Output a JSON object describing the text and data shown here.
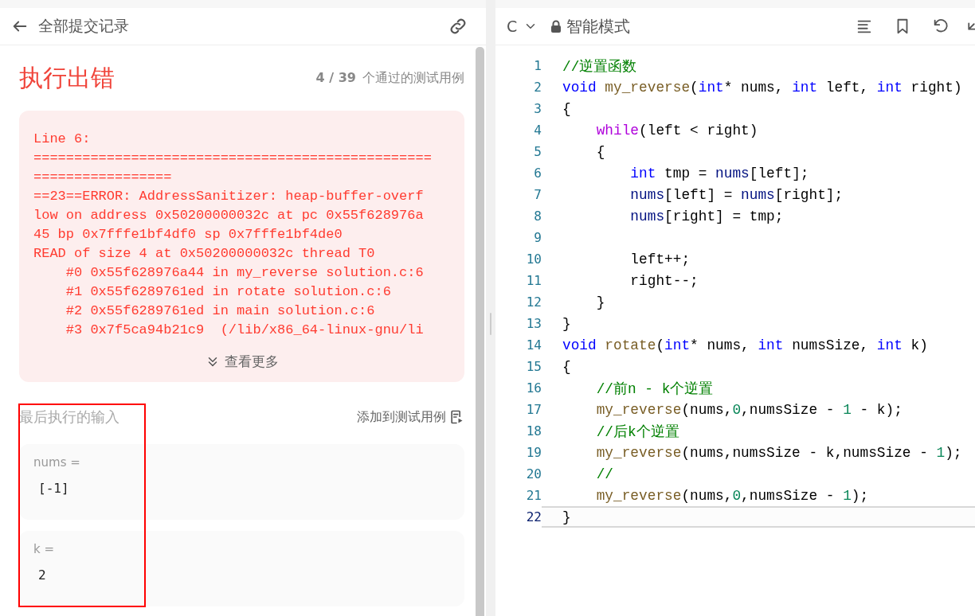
{
  "header": {
    "title": "全部提交记录"
  },
  "result": {
    "status": "执行出错",
    "passed": "4 / 39",
    "passed_label": "个通过的测试用例"
  },
  "error": {
    "lines": [
      "Line 6:",
      "=================================================",
      "=================",
      "==23==ERROR: AddressSanitizer: heap-buffer-overf",
      "low on address 0x50200000032c at pc 0x55f628976a",
      "45 bp 0x7fffe1bf4df0 sp 0x7fffe1bf4de0",
      "READ of size 4 at 0x50200000032c thread T0",
      "    #0 0x55f628976a44 in my_reverse solution.c:6",
      "    #1 0x55f6289761ed in rotate solution.c:6",
      "    #2 0x55f6289761ed in main solution.c:6",
      "    #3 0x7f5ca94b21c9  (/lib/x86_64-linux-gnu/li"
    ],
    "more": "查看更多"
  },
  "last_input": {
    "title": "最后执行的输入",
    "add_link": "添加到测试用例",
    "params": [
      {
        "name": "nums =",
        "value": "[-1]"
      },
      {
        "name": "k =",
        "value": "2"
      }
    ]
  },
  "editor": {
    "language": "C",
    "mode": "智能模式",
    "lines": [
      {
        "number": "1",
        "active": false,
        "tokens": [
          {
            "kind": "comment",
            "text": "//逆置函数"
          }
        ]
      },
      {
        "number": "2",
        "active": false,
        "tokens": [
          {
            "kind": "kw",
            "text": "void "
          },
          {
            "kind": "fn",
            "text": "my_reverse"
          },
          {
            "kind": "plain",
            "text": "("
          },
          {
            "kind": "kw",
            "text": "int"
          },
          {
            "kind": "plain",
            "text": "* nums, "
          },
          {
            "kind": "kw",
            "text": "int"
          },
          {
            "kind": "plain",
            "text": " left, "
          },
          {
            "kind": "kw",
            "text": "int"
          },
          {
            "kind": "plain",
            "text": " right)"
          }
        ]
      },
      {
        "number": "3",
        "active": false,
        "tokens": [
          {
            "kind": "plain",
            "text": "{"
          }
        ]
      },
      {
        "number": "4",
        "active": false,
        "tokens": [
          {
            "kind": "ctrl",
            "text": "    while"
          },
          {
            "kind": "plain",
            "text": "(left < right)"
          }
        ]
      },
      {
        "number": "5",
        "active": false,
        "tokens": [
          {
            "kind": "plain",
            "text": "    {"
          }
        ]
      },
      {
        "number": "6",
        "active": false,
        "tokens": [
          {
            "kind": "kw",
            "text": "        int"
          },
          {
            "kind": "plain",
            "text": " tmp = "
          },
          {
            "kind": "var",
            "text": "nums"
          },
          {
            "kind": "plain",
            "text": "[left];"
          }
        ]
      },
      {
        "number": "7",
        "active": false,
        "tokens": [
          {
            "kind": "var",
            "text": "        nums"
          },
          {
            "kind": "plain",
            "text": "[left] = "
          },
          {
            "kind": "var",
            "text": "nums"
          },
          {
            "kind": "plain",
            "text": "[right];"
          }
        ]
      },
      {
        "number": "8",
        "active": false,
        "tokens": [
          {
            "kind": "var",
            "text": "        nums"
          },
          {
            "kind": "plain",
            "text": "[right] = tmp;"
          }
        ]
      },
      {
        "number": "9",
        "active": false
      },
      {
        "number": "10",
        "active": false,
        "tokens": [
          {
            "kind": "plain",
            "text": "        left++;"
          }
        ]
      },
      {
        "number": "11",
        "active": false,
        "tokens": [
          {
            "kind": "plain",
            "text": "        right--;"
          }
        ]
      },
      {
        "number": "12",
        "active": false,
        "tokens": [
          {
            "kind": "plain",
            "text": "    }"
          }
        ]
      },
      {
        "number": "13",
        "active": false,
        "tokens": [
          {
            "kind": "plain",
            "text": "}"
          }
        ]
      },
      {
        "number": "14",
        "active": false,
        "tokens": [
          {
            "kind": "kw",
            "text": "void "
          },
          {
            "kind": "fn",
            "text": "rotate"
          },
          {
            "kind": "plain",
            "text": "("
          },
          {
            "kind": "kw",
            "text": "int"
          },
          {
            "kind": "plain",
            "text": "* nums, "
          },
          {
            "kind": "kw",
            "text": "int"
          },
          {
            "kind": "plain",
            "text": " numsSize, "
          },
          {
            "kind": "kw",
            "text": "int"
          },
          {
            "kind": "plain",
            "text": " k)"
          }
        ]
      },
      {
        "number": "15",
        "active": false,
        "tokens": [
          {
            "kind": "plain",
            "text": "{"
          }
        ]
      },
      {
        "number": "16",
        "active": false,
        "tokens": [
          {
            "kind": "comment",
            "text": "    //前n - k个逆置"
          }
        ]
      },
      {
        "number": "17",
        "active": false,
        "tokens": [
          {
            "kind": "fn",
            "text": "    my_reverse"
          },
          {
            "kind": "plain",
            "text": "(nums,"
          },
          {
            "kind": "num",
            "text": "0"
          },
          {
            "kind": "plain",
            "text": ",numsSize - "
          },
          {
            "kind": "num",
            "text": "1"
          },
          {
            "kind": "plain",
            "text": " - k);"
          }
        ]
      },
      {
        "number": "18",
        "active": false,
        "tokens": [
          {
            "kind": "comment",
            "text": "    //后k个逆置"
          }
        ]
      },
      {
        "number": "19",
        "active": false,
        "tokens": [
          {
            "kind": "fn",
            "text": "    my_reverse"
          },
          {
            "kind": "plain",
            "text": "(nums,numsSize - k,numsSize - "
          },
          {
            "kind": "num",
            "text": "1"
          },
          {
            "kind": "plain",
            "text": ");"
          }
        ]
      },
      {
        "number": "20",
        "active": false,
        "tokens": [
          {
            "kind": "comment",
            "text": "    //"
          }
        ]
      },
      {
        "number": "21",
        "active": false,
        "tokens": [
          {
            "kind": "fn",
            "text": "    my_reverse"
          },
          {
            "kind": "plain",
            "text": "(nums,"
          },
          {
            "kind": "num",
            "text": "0"
          },
          {
            "kind": "plain",
            "text": ",numsSize - "
          },
          {
            "kind": "num",
            "text": "1"
          },
          {
            "kind": "plain",
            "text": ");"
          }
        ]
      },
      {
        "number": "22",
        "active": true,
        "tokens": [
          {
            "kind": "plain",
            "text": "}"
          }
        ]
      }
    ]
  }
}
